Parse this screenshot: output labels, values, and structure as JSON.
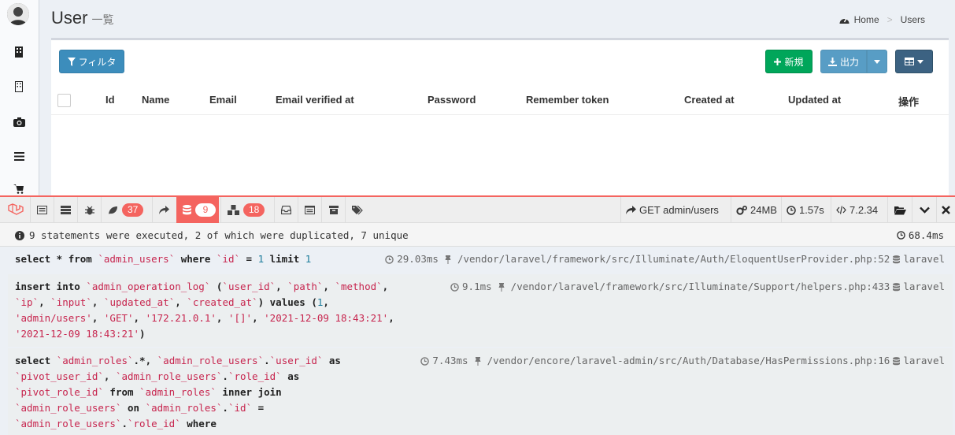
{
  "page": {
    "title": "User",
    "subtitle": "一覧"
  },
  "breadcrumb": {
    "home": "Home",
    "current": "Users"
  },
  "toolbar": {
    "filter": "フィルタ",
    "new": "新規",
    "export": "出力"
  },
  "table": {
    "columns": [
      "Id",
      "Name",
      "Email",
      "Email verified at",
      "Password",
      "Remember token",
      "Created at",
      "Updated at",
      "操作"
    ],
    "rows": []
  },
  "debugbar": {
    "badges": {
      "messages": "37",
      "queries": "9",
      "models": "18"
    },
    "request": "GET admin/users",
    "memory": "24MB",
    "time": "1.57s",
    "php": "7.2.34"
  },
  "queries": {
    "summary": "9 statements were executed, 2 of which were duplicated, 7 unique",
    "total_duration": "68.4ms",
    "items": [
      {
        "duration": "29.03ms",
        "path": "/vendor/laravel/framework/src/Illuminate/Auth/EloquentUserProvider.php:52",
        "connection": "laravel"
      },
      {
        "duration": "9.1ms",
        "path": "/vendor/laravel/framework/src/Illuminate/Support/helpers.php:433",
        "connection": "laravel"
      },
      {
        "duration": "7.43ms",
        "path": "/vendor/encore/laravel-admin/src/Auth/Database/HasPermissions.php:16",
        "connection": "laravel"
      }
    ]
  },
  "colors": {
    "primary": "#3c8dbc",
    "success": "#00a65a",
    "debugbar_accent": "#f4645f",
    "sql_string": "#c7254e"
  }
}
